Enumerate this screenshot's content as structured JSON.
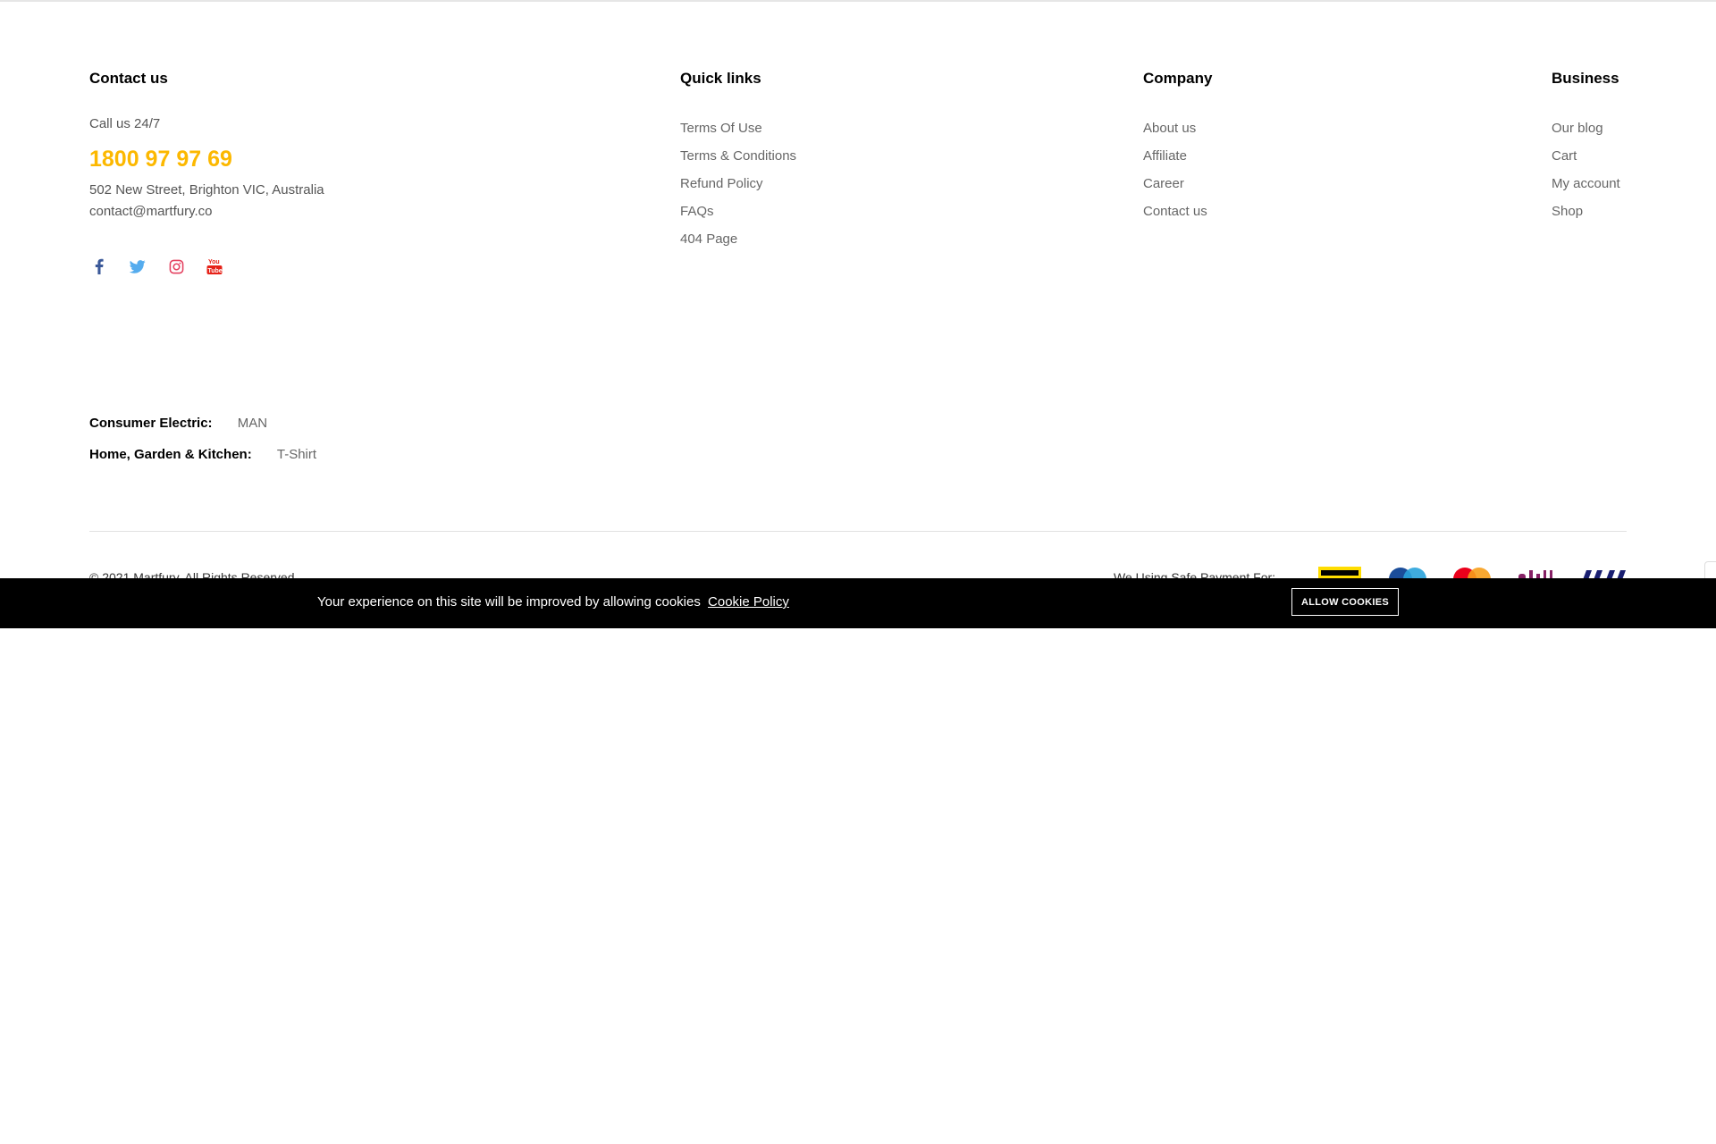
{
  "footer": {
    "contact": {
      "title": "Contact us",
      "call_label": "Call us 24/7",
      "phone": "1800 97 97 69",
      "address": "502 New Street, Brighton VIC, Australia",
      "email": "contact@martfury.co",
      "social": [
        "facebook-icon",
        "twitter-icon",
        "instagram-icon",
        "youtube-icon"
      ]
    },
    "quick_links": {
      "title": "Quick links",
      "items": [
        "Terms Of Use",
        "Terms & Conditions",
        "Refund Policy",
        "FAQs",
        "404 Page"
      ]
    },
    "company": {
      "title": "Company",
      "items": [
        "About us",
        "Affiliate",
        "Career",
        "Contact us"
      ]
    },
    "business": {
      "title": "Business",
      "items": [
        "Our blog",
        "Cart",
        "My account",
        "Shop"
      ]
    },
    "categories": [
      {
        "label": "Consumer Electric:",
        "value": "MAN"
      },
      {
        "label": "Home, Garden & Kitchen:",
        "value": "T-Shirt"
      }
    ],
    "copyright": "© 2021 Martfury. All Rights Reserved",
    "payment_label": "We Using Safe Payment For:",
    "payment_icons": [
      "western-union-icon",
      "maestro-icon",
      "mastercard-icon",
      "skrill-icon",
      "visa-icon"
    ]
  },
  "cookie_bar": {
    "text": "Your experience on this site will be improved by allowing cookies",
    "link": "Cookie Policy",
    "button": "ALLOW COOKIES"
  },
  "colors": {
    "accent": "#fcb800",
    "facebook": "#3b5999",
    "twitter": "#55acee",
    "instagram": "#e4405f",
    "youtube": "#e62117",
    "cookie_bg": "#000000"
  }
}
